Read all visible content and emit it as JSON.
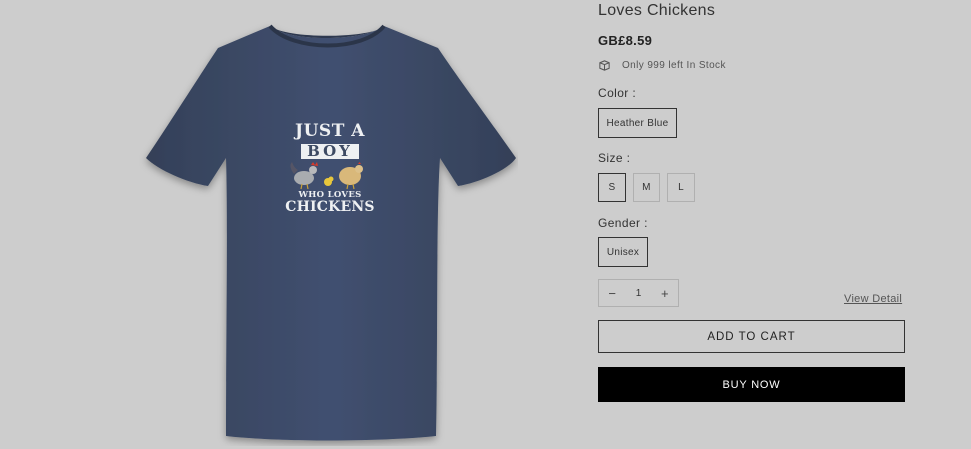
{
  "product": {
    "title": "Loves Chickens",
    "price": "GB£8.59",
    "stock_text": "Only 999 left In Stock",
    "shirt_color": "#3d4a63"
  },
  "print": {
    "line1": "JUST A",
    "line2": "BOY",
    "line3": "WHO LOVES",
    "line4": "CHICKENS"
  },
  "options": {
    "color": {
      "label": "Color :",
      "values": [
        "Heather Blue"
      ],
      "selected": "Heather Blue"
    },
    "size": {
      "label": "Size :",
      "values": [
        "S",
        "M",
        "L"
      ],
      "selected": "S"
    },
    "gender": {
      "label": "Gender :",
      "values": [
        "Unisex"
      ],
      "selected": "Unisex"
    }
  },
  "quantity": {
    "minus": "−",
    "value": "1",
    "plus": "+"
  },
  "links": {
    "view_detail": "View Detail"
  },
  "buttons": {
    "add_to_cart": "ADD TO CART",
    "buy_now": "BUY NOW"
  }
}
